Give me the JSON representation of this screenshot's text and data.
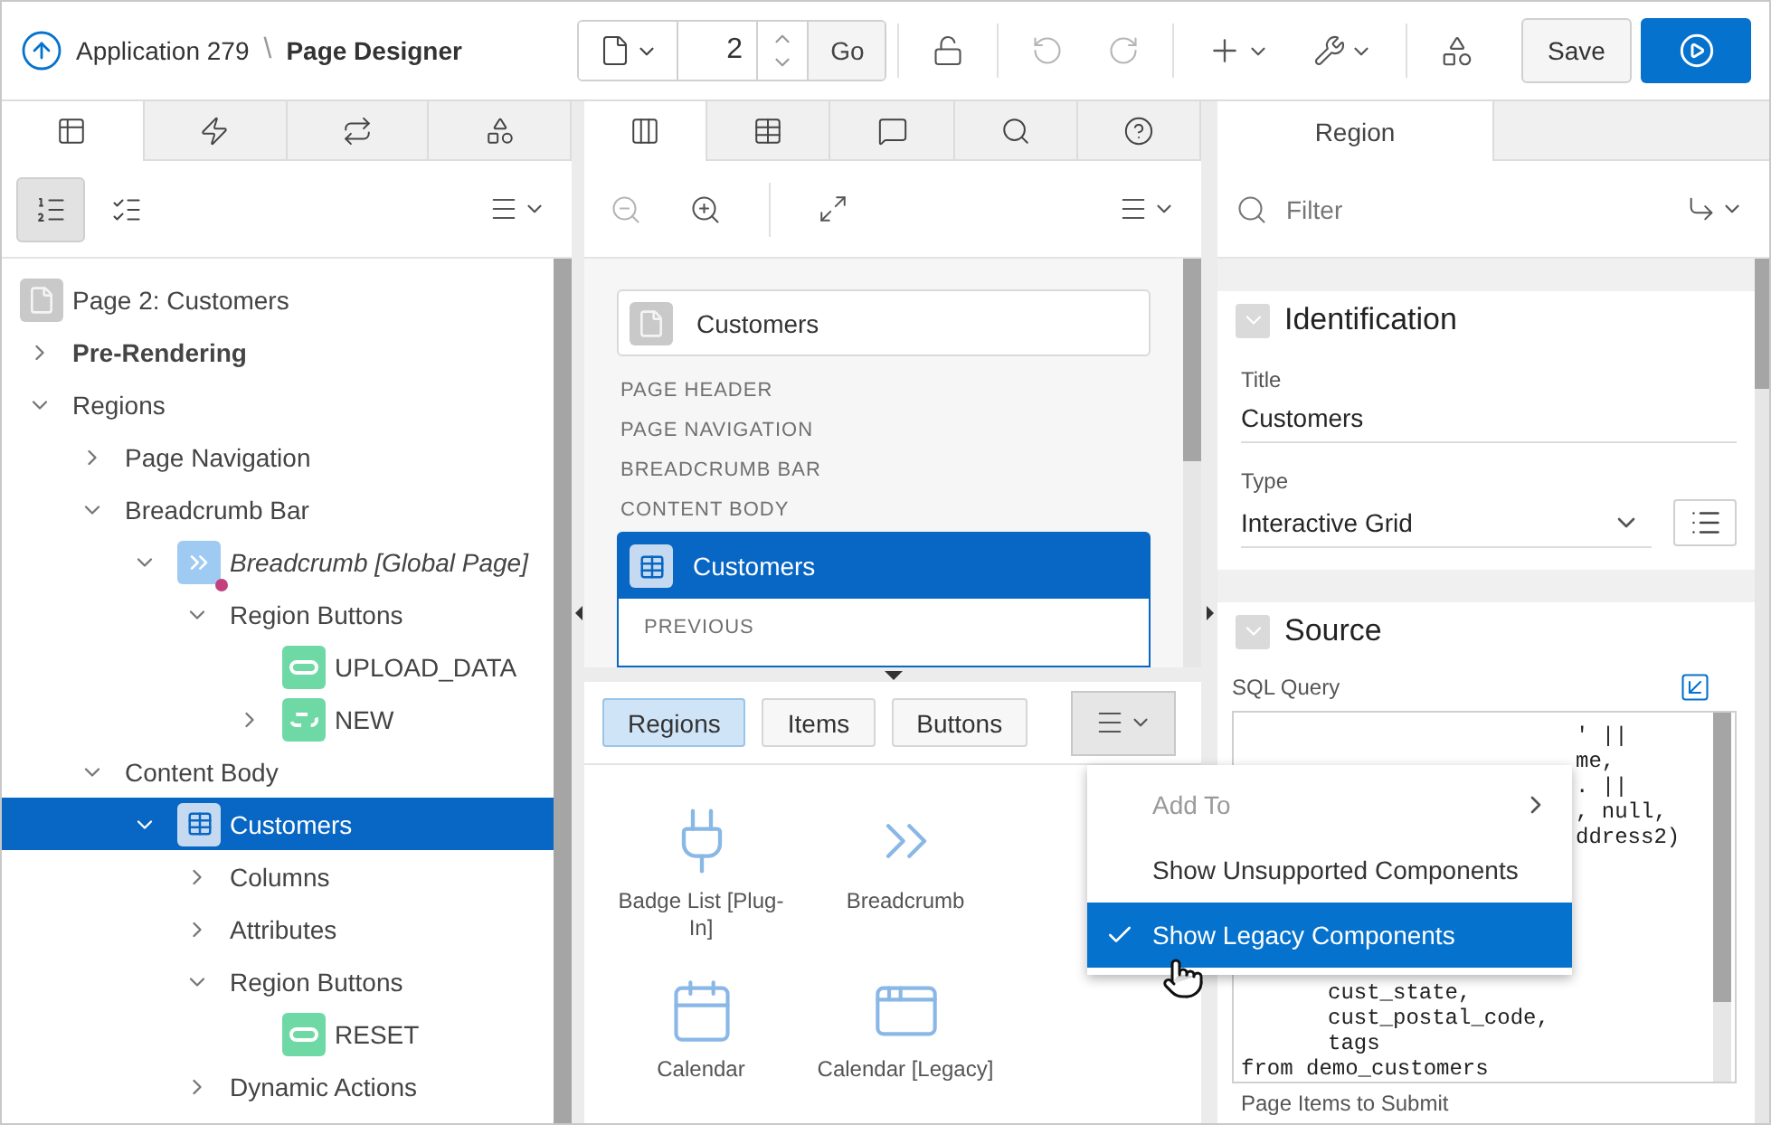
{
  "header": {
    "app": "Application 279",
    "separator": "\\",
    "page_title": "Page Designer",
    "page_number": "2",
    "go": "Go",
    "undo_disabled": true,
    "redo_disabled": true,
    "save": "Save"
  },
  "left_panel": {
    "tabs": [
      {
        "kind": "rendering",
        "selected": true
      },
      {
        "kind": "dynamic-actions",
        "selected": false
      },
      {
        "kind": "processing",
        "selected": false
      },
      {
        "kind": "shared",
        "selected": false
      }
    ],
    "view_toggles": [
      {
        "kind": "ordered",
        "selected": true
      },
      {
        "kind": "grouped",
        "selected": false
      }
    ],
    "tree": {
      "label": "Page 2: Customers",
      "kind": "page",
      "children": [
        {
          "label": "Pre-Rendering",
          "kind": "section",
          "expanded": false
        },
        {
          "label": "Regions",
          "expanded": true,
          "children": [
            {
              "label": "Page Navigation",
              "expanded": false
            },
            {
              "label": "Breadcrumb Bar",
              "expanded": true,
              "children": [
                {
                  "label": "Breadcrumb [Global Page]",
                  "kind": "shared-region",
                  "expanded": true,
                  "children": [
                    {
                      "label": "Region Buttons",
                      "expanded": true,
                      "children": [
                        {
                          "label": "UPLOAD_DATA",
                          "kind": "button"
                        },
                        {
                          "label": "NEW",
                          "kind": "dynamic-button",
                          "expanded": false
                        }
                      ]
                    }
                  ]
                }
              ]
            },
            {
              "label": "Content Body",
              "expanded": true,
              "children": [
                {
                  "label": "Customers",
                  "kind": "grid-region",
                  "selected": true,
                  "expanded": true,
                  "children": [
                    {
                      "label": "Columns",
                      "expanded": false
                    },
                    {
                      "label": "Attributes",
                      "expanded": false
                    },
                    {
                      "label": "Region Buttons",
                      "expanded": true,
                      "children": [
                        {
                          "label": "RESET",
                          "kind": "button"
                        }
                      ]
                    },
                    {
                      "label": "Dynamic Actions",
                      "expanded": false
                    }
                  ]
                }
              ]
            }
          ]
        }
      ]
    }
  },
  "middle_panel": {
    "tabs": [
      {
        "kind": "layout",
        "selected": true
      },
      {
        "kind": "grid",
        "selected": false
      },
      {
        "kind": "comments",
        "selected": false
      },
      {
        "kind": "search",
        "selected": false
      },
      {
        "kind": "help",
        "selected": false
      }
    ],
    "zoom_out_disabled": true,
    "canvas": {
      "page_card": "Customers",
      "sections": [
        "PAGE HEADER",
        "PAGE NAVIGATION",
        "BREADCRUMB BAR",
        "CONTENT BODY"
      ],
      "region": {
        "title": "Customers",
        "body": "PREVIOUS"
      }
    },
    "gallery": {
      "filters": [
        {
          "label": "Regions",
          "selected": true
        },
        {
          "label": "Items",
          "selected": false
        },
        {
          "label": "Buttons",
          "selected": false
        }
      ],
      "items": [
        {
          "label": "Badge List [Plug-In]",
          "kind": "plugin"
        },
        {
          "label": "Breadcrumb",
          "kind": "breadcrumb"
        },
        {
          "label": "Calendar",
          "kind": "calendar"
        },
        {
          "label": "Calendar [Legacy]",
          "kind": "legacy"
        }
      ],
      "menu": [
        {
          "label": "Add To",
          "kind": "submenu",
          "disabled": true
        },
        {
          "label": "Show Unsupported Components",
          "kind": "toggle",
          "checked": false,
          "selected": false
        },
        {
          "label": "Show Legacy Components",
          "kind": "toggle",
          "checked": true,
          "selected": true
        }
      ]
    }
  },
  "right_panel": {
    "tabs": [
      {
        "label": "Region",
        "selected": true
      }
    ],
    "filter": {
      "placeholder": "Filter"
    },
    "sections": [
      {
        "title": "Identification",
        "expanded": true,
        "fields": [
          {
            "kind": "text",
            "label": "Title",
            "value": "Customers"
          },
          {
            "kind": "select",
            "label": "Type",
            "value": "Interactive Grid"
          }
        ]
      },
      {
        "title": "Source",
        "expanded": true,
        "fields": [
          {
            "kind": "code",
            "label": "SQL Query",
            "lines": [
              {
                "kind": "tail",
                "text": "' ||"
              },
              {
                "kind": "tail",
                "text": "me,"
              },
              {
                "kind": "tail",
                "text": ". ||"
              },
              {
                "kind": "tail",
                "text": ", null,"
              },
              {
                "kind": "tail",
                "text": "ddress2)"
              },
              {
                "kind": "indented",
                "text": "cust_state,"
              },
              {
                "kind": "indented",
                "text": "cust_postal_code,"
              },
              {
                "kind": "indented",
                "text": "tags"
              },
              {
                "kind": "plain",
                "text": "from demo_customers"
              }
            ]
          },
          {
            "kind": "label",
            "label": "Page Items to Submit"
          }
        ]
      }
    ]
  }
}
